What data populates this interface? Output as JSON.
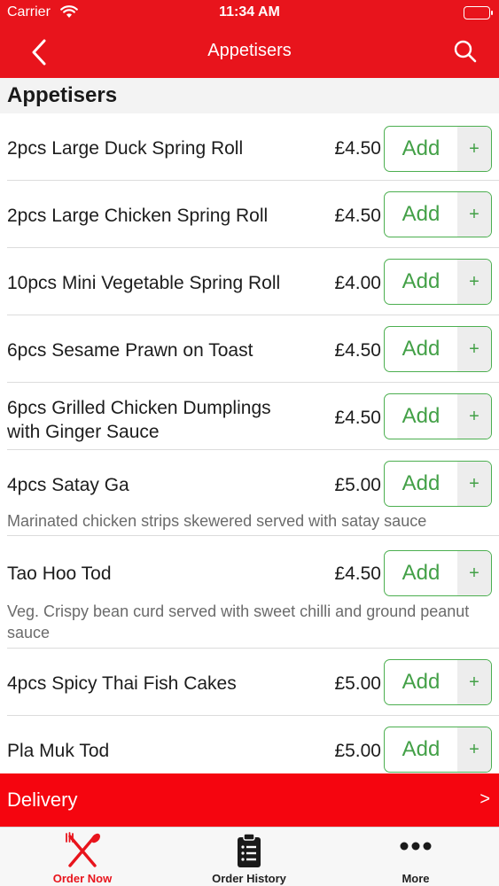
{
  "status_bar": {
    "carrier": "Carrier",
    "time": "11:34 AM"
  },
  "nav": {
    "title": "Appetisers",
    "back_icon": "chevron-left-icon",
    "search_icon": "search-icon"
  },
  "section": {
    "title": "Appetisers"
  },
  "items": [
    {
      "name": "2pcs Large Duck Spring Roll",
      "price": "£4.50",
      "add": "Add",
      "plus": "+"
    },
    {
      "name": "2pcs Large Chicken Spring Roll",
      "price": "£4.50",
      "add": "Add",
      "plus": "+"
    },
    {
      "name": "10pcs Mini Vegetable Spring Roll",
      "price": "£4.00",
      "add": "Add",
      "plus": "+"
    },
    {
      "name": "6pcs Sesame Prawn on Toast",
      "price": "£4.50",
      "add": "Add",
      "plus": "+"
    },
    {
      "name": "6pcs Grilled Chicken Dumplings with Ginger Sauce",
      "price": "£4.50",
      "add": "Add",
      "plus": "+"
    },
    {
      "name": "4pcs Satay Ga",
      "price": "£5.00",
      "add": "Add",
      "plus": "+",
      "description": "Marinated chicken strips skewered served with satay sauce"
    },
    {
      "name": "Tao Hoo Tod",
      "price": "£4.50",
      "add": "Add",
      "plus": "+",
      "description": "Veg. Crispy bean curd served with sweet chilli and ground peanut sauce"
    },
    {
      "name": "4pcs Spicy Thai Fish Cakes",
      "price": "£5.00",
      "add": "Add",
      "plus": "+"
    },
    {
      "name": "Pla Muk Tod",
      "price": "£5.00",
      "add": "Add",
      "plus": "+"
    }
  ],
  "delivery": {
    "label": "Delivery",
    "chevron": ">"
  },
  "tabs": [
    {
      "label": "Order Now",
      "icon": "fork-knife-icon",
      "active": true
    },
    {
      "label": "Order History",
      "icon": "clipboard-list-icon",
      "active": false
    },
    {
      "label": "More",
      "icon": "more-dots-icon",
      "active": false
    }
  ],
  "colors": {
    "brand_red": "#e8141c",
    "add_green": "#43a047",
    "active_tab": "#e8141c"
  }
}
